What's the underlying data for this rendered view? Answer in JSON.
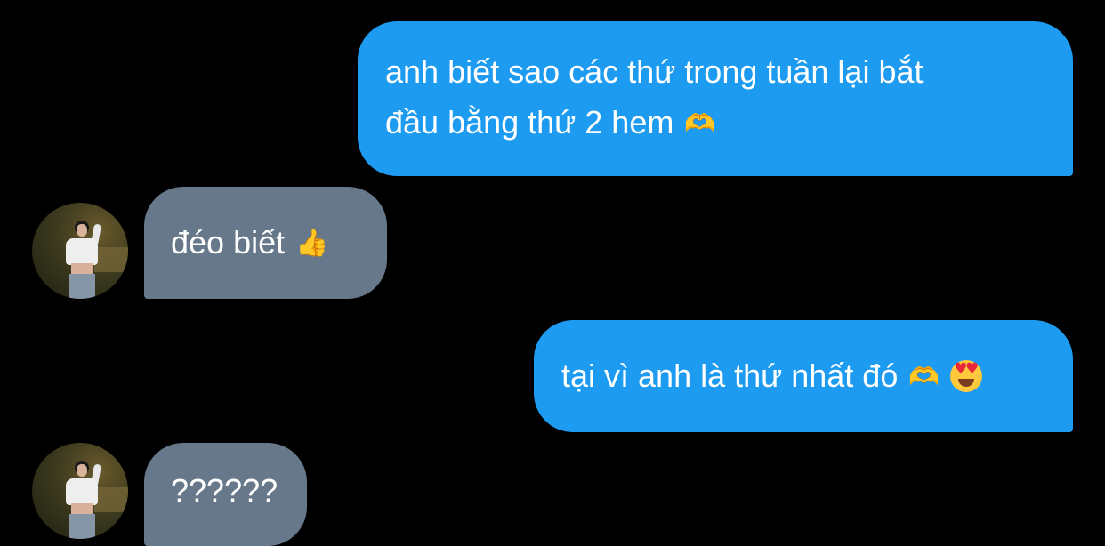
{
  "messages": [
    {
      "direction": "outgoing",
      "lines": [
        "anh biết sao các thứ trong tuần lại bắt",
        "đầu bằng thứ 2 hem"
      ],
      "emojis": [
        "heart-hands-emoji"
      ]
    },
    {
      "direction": "incoming",
      "text": "đéo biết",
      "emojis": [
        "thumbs-up-emoji"
      ]
    },
    {
      "direction": "outgoing",
      "text": "tại vì anh là thứ nhất đó",
      "emojis": [
        "heart-hands-emoji",
        "smiling-face-with-heart-eyes-emoji"
      ]
    },
    {
      "direction": "incoming",
      "text": "??????",
      "emojis": []
    }
  ],
  "colors": {
    "background": "#000000",
    "outgoing_bubble": "#1d9bf0",
    "incoming_bubble": "#66788a",
    "text": "#ffffff"
  }
}
